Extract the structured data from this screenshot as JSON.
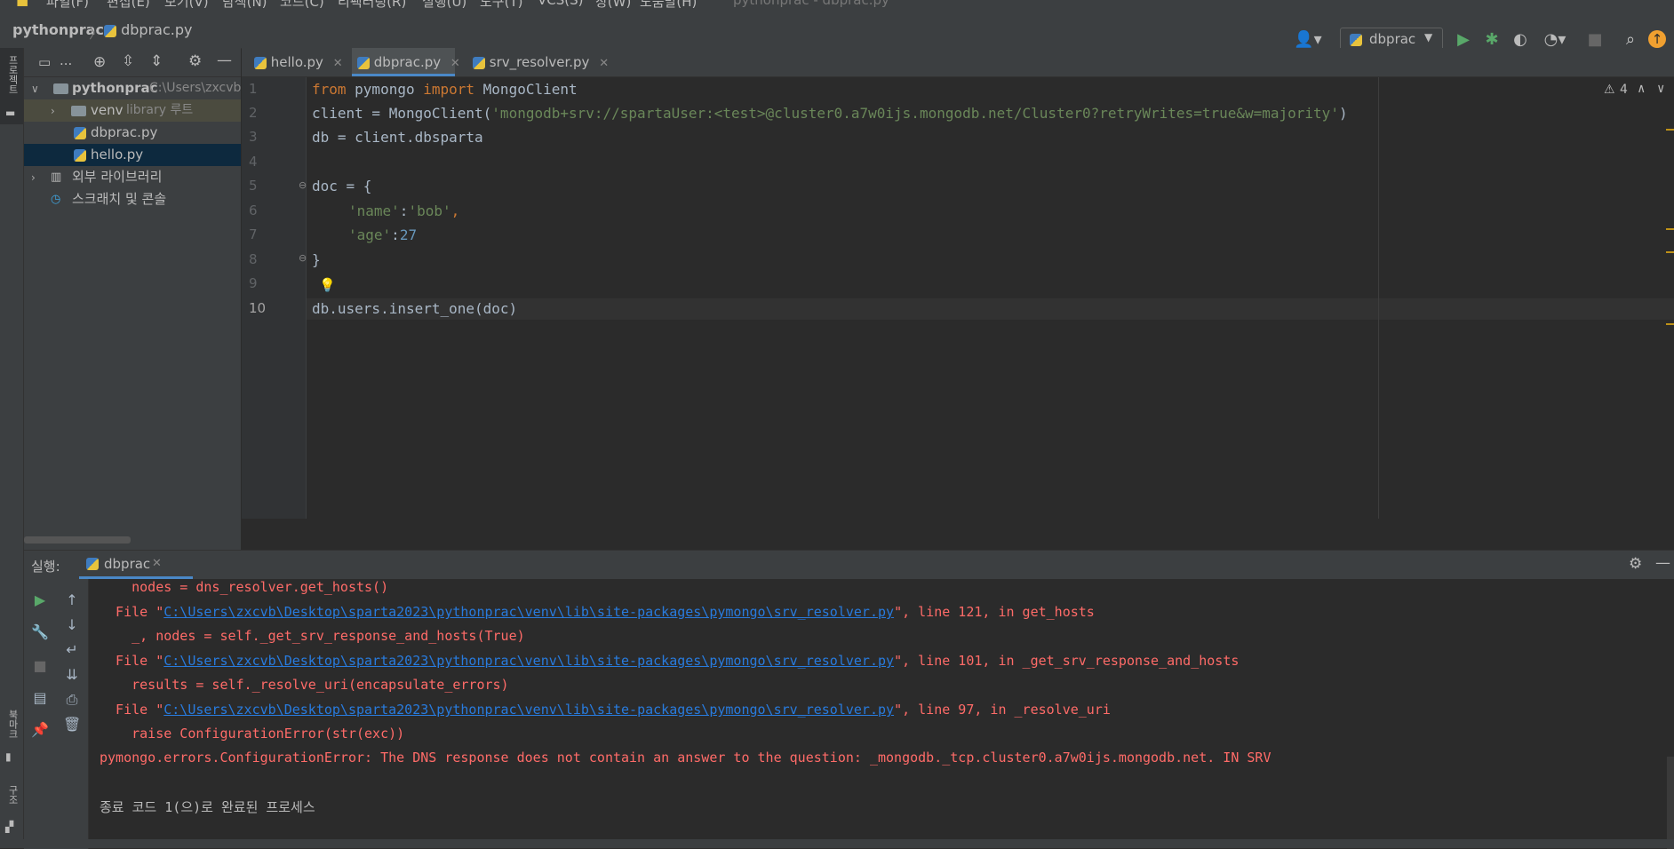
{
  "menu": {
    "items": [
      "파일(F)",
      "편집(E)",
      "보기(V)",
      "탐색(N)",
      "코드(C)",
      "리팩터링(R)",
      "실행(U)",
      "도구(T)",
      "VCS(S)",
      "창(W)",
      "도움말(H)"
    ],
    "window_title": "pythonprac - dbprac.py"
  },
  "nav": {
    "project": "pythonprac",
    "file": "dbprac.py",
    "run_config": "dbprac"
  },
  "left_strip": {
    "project_label": "프로젝트",
    "bookmarks_label": "북마크",
    "structure_label": "구조"
  },
  "project_panel": {
    "header_label": "...",
    "root_name": "pythonprac",
    "root_path": "C:\\Users\\zxcvb",
    "venv_name": "venv",
    "venv_tag": "library 루트",
    "file1": "dbprac.py",
    "file2": "hello.py",
    "external_libs": "외부 라이브러리",
    "scratches": "스크래치 및 콘솔"
  },
  "editor": {
    "tabs": [
      "hello.py",
      "dbprac.py",
      "srv_resolver.py"
    ],
    "warning_count": "4",
    "line_numbers": [
      "1",
      "2",
      "3",
      "4",
      "5",
      "6",
      "7",
      "8",
      "9",
      "10"
    ],
    "code": {
      "l1_from": "from",
      "l1_mod": " pymongo ",
      "l1_import": "import",
      "l1_cls": " MongoClient",
      "l2_pre": "client = MongoClient(",
      "l2_str": "'mongodb+srv://spartaUser:<test>@cluster0.a7w0ijs.mongodb.net/Cluster0?retryWrites=true&w=majority'",
      "l2_post": ")",
      "l3": "db = client.dbsparta",
      "l5": "doc = {",
      "l6_key": "'name'",
      "l6_colon": ":",
      "l6_val": "'bob'",
      "l6_comma": ",",
      "l7_key": "'age'",
      "l7_colon": ":",
      "l7_val": "27",
      "l8": "}",
      "l10": "db.users.insert_one(doc)"
    }
  },
  "run": {
    "label": "실행:",
    "tab": "dbprac",
    "console": {
      "c1": "    nodes = dns_resolver.get_hosts()",
      "c2_pre": "  File \"",
      "c2_link": "C:\\Users\\zxcvb\\Desktop\\sparta2023\\pythonprac\\venv\\lib\\site-packages\\pymongo\\srv_resolver.py",
      "c2_post": "\", line 121, in get_hosts",
      "c3": "    _, nodes = self._get_srv_response_and_hosts(True)",
      "c4_pre": "  File \"",
      "c4_link": "C:\\Users\\zxcvb\\Desktop\\sparta2023\\pythonprac\\venv\\lib\\site-packages\\pymongo\\srv_resolver.py",
      "c4_post": "\", line 101, in _get_srv_response_and_hosts",
      "c5": "    results = self._resolve_uri(encapsulate_errors)",
      "c6_pre": "  File \"",
      "c6_link": "C:\\Users\\zxcvb\\Desktop\\sparta2023\\pythonprac\\venv\\lib\\site-packages\\pymongo\\srv_resolver.py",
      "c6_post": "\", line 97, in _resolve_uri",
      "c7": "    raise ConfigurationError(str(exc))",
      "c8": "pymongo.errors.ConfigurationError: The DNS response does not contain an answer to the question: _mongodb._tcp.cluster0.a7w0ijs.mongodb.net. IN SRV",
      "c9": "종료 코드 1(으)로 완료된 프로세스"
    }
  },
  "colors": {
    "keyword": "#cc7832",
    "string": "#6a8759",
    "number": "#6897bb",
    "error": "#ff6b68",
    "link": "#287bde",
    "run_green": "#59a869"
  }
}
